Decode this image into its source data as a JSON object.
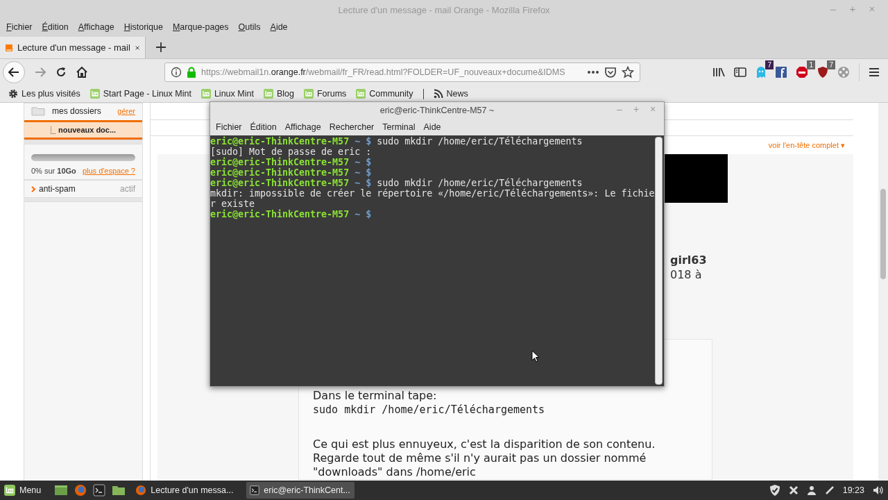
{
  "window": {
    "title": "Lecture d'un message - mail Orange - Mozilla Firefox",
    "controls": [
      "–",
      "+",
      "×"
    ]
  },
  "menu_bar": [
    "Fichier",
    "Édition",
    "Affichage",
    "Historique",
    "Marque-pages",
    "Outils",
    "Aide"
  ],
  "tabs": [
    {
      "label": "Lecture d'un message - mail",
      "selected": true
    }
  ],
  "address_bar": {
    "url_start": "https://webmail1n.",
    "url_host": "orange.fr",
    "url_end": "/webmail/fr_FR/read.html?FOLDER=UF_nouveaux+docume&IDMS"
  },
  "extensions": [
    {
      "kind": "ghost",
      "badge": "7"
    },
    {
      "kind": "facebook"
    },
    {
      "kind": "adblock",
      "badge": "1"
    },
    {
      "kind": "ublock",
      "badge": "7"
    },
    {
      "kind": "reel"
    }
  ],
  "bookmarks": [
    {
      "kind": "gear",
      "label": "Les plus visités"
    },
    {
      "kind": "mint",
      "label": "Start Page - Linux Mint"
    },
    {
      "kind": "mint",
      "label": "Linux Mint"
    },
    {
      "kind": "mint",
      "label": "Blog"
    },
    {
      "kind": "mint",
      "label": "Forums"
    },
    {
      "kind": "mint",
      "label": "Community"
    },
    {
      "kind": "separator"
    },
    {
      "kind": "feed",
      "label": "News"
    }
  ],
  "sidebar": {
    "folders_label": "mes dossiers",
    "manage_link": "gérer",
    "folders": [
      {
        "label": "nouveaux doc...",
        "selected": true
      }
    ],
    "storage": {
      "level": 0,
      "usage": "0% sur **10Go**",
      "more_link": "plus d'espace ?"
    },
    "antispam": {
      "label": "anti-spam",
      "status": "actif"
    }
  },
  "message": {
    "header_link": "voir l'en-tête complet ▾",
    "intro_fragments": [
      {
        "kind": "bold",
        "text": "girl63"
      },
      {
        "kind": "plain",
        "text": "018 à"
      }
    ],
    "quote": [
      {
        "kind": "text",
        "text": "Dans le terminal tape:"
      },
      {
        "kind": "code",
        "text": "sudo mkdir /home/eric/Téléchargements"
      },
      {
        "kind": "blank"
      },
      {
        "kind": "text",
        "text": "Ce qui est plus ennuyeux, c'est la disparition de son contenu."
      },
      {
        "kind": "text",
        "text": "Regarde tout de même s'il n'y aurait pas un dossier nommé"
      },
      {
        "kind": "text",
        "text": "\"downloads\" dans /home/eric"
      }
    ]
  },
  "terminal": {
    "title": "eric@eric-ThinkCentre-M57 ~",
    "controls": [
      "–",
      "+",
      "×"
    ],
    "menu": [
      "Fichier",
      "Édition",
      "Affichage",
      "Rechercher",
      "Terminal",
      "Aide"
    ],
    "lines": [
      {
        "kind": "prompt",
        "user": "eric@eric-ThinkCentre-M57",
        "path": "~ $",
        "command": "sudo mkdir /home/eric/Téléchargements"
      },
      {
        "kind": "output",
        "text": "[sudo] Mot de passe de eric :"
      },
      {
        "kind": "prompt",
        "user": "eric@eric-ThinkCentre-M57",
        "path": "~ $"
      },
      {
        "kind": "prompt",
        "user": "eric@eric-ThinkCentre-M57",
        "path": "~ $"
      },
      {
        "kind": "prompt",
        "user": "eric@eric-ThinkCentre-M57",
        "path": "~ $",
        "command": "sudo mkdir /home/eric/Téléchargements"
      },
      {
        "kind": "output",
        "text": "mkdir: impossible de créer le répertoire «/home/eric/Téléchargements»: Le fichie"
      },
      {
        "kind": "output",
        "text": "r existe"
      },
      {
        "kind": "prompt",
        "user": "eric@eric-ThinkCentre-M57",
        "path": "~ $"
      }
    ]
  },
  "taskbar": {
    "menu_label": "Menu",
    "windows": [
      {
        "kind": "firefox",
        "label": "Lecture d'un messa...",
        "selected": false
      },
      {
        "kind": "terminal",
        "label": "eric@eric-ThinkCent...",
        "selected": true
      }
    ],
    "clock": "19:23"
  }
}
